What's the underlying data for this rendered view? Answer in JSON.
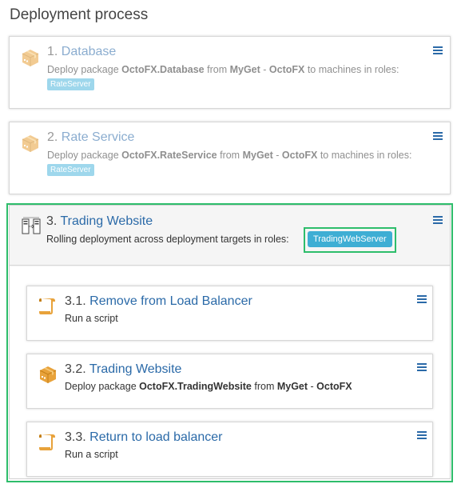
{
  "page": {
    "title": "Deployment process"
  },
  "steps": [
    {
      "number": "1.",
      "name": "Database",
      "desc_prefix": "Deploy package ",
      "package": "OctoFX.Database",
      "desc_from": " from ",
      "feed_a": "MyGet",
      "feed_sep": " - ",
      "feed_b": "OctoFX",
      "desc_suffix": " to machines in roles:",
      "role": "RateServer"
    },
    {
      "number": "2.",
      "name": "Rate Service",
      "desc_prefix": "Deploy package ",
      "package": "OctoFX.RateService",
      "desc_from": " from ",
      "feed_a": "MyGet",
      "feed_sep": " - ",
      "feed_b": "OctoFX",
      "desc_suffix": " to machines in roles:",
      "role": "RateServer"
    }
  ],
  "rolling": {
    "number": "3.",
    "name": "Trading Website",
    "desc": "Rolling deployment across deployment targets in roles:",
    "role": "TradingWebServer",
    "children": [
      {
        "number": "3.1.",
        "name": "Remove from Load Balancer",
        "desc": "Run a script"
      },
      {
        "number": "3.2.",
        "name": "Trading Website",
        "desc_prefix": "Deploy package ",
        "package": "OctoFX.TradingWebsite",
        "desc_from": " from ",
        "feed_a": "MyGet",
        "feed_sep": " - ",
        "feed_b": "OctoFX"
      },
      {
        "number": "3.3.",
        "name": "Return to load balancer",
        "desc": "Run a script"
      }
    ]
  },
  "colors": {
    "link": "#2b6aa8",
    "role_tag": "#4fb8dd",
    "highlight": "#2ebd6b",
    "package_icon": "#e8a23a"
  }
}
